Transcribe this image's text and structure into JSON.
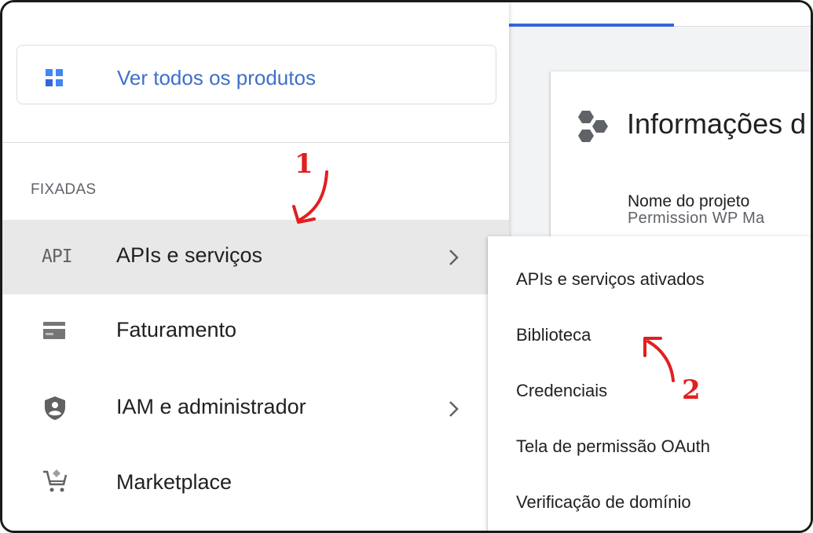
{
  "nav": {
    "all_products": {
      "label": "Ver todos os produtos",
      "icon": "grid-icon"
    },
    "section_label": "FIXADAS",
    "items": [
      {
        "label": "APIs e serviços",
        "icon": "api-icon",
        "icon_text": "API",
        "has_submenu": true,
        "active": true
      },
      {
        "label": "Faturamento",
        "icon": "billing-icon",
        "has_submenu": false
      },
      {
        "label": "IAM e administrador",
        "icon": "shield-icon",
        "has_submenu": true
      },
      {
        "label": "Marketplace",
        "icon": "cart-icon",
        "has_submenu": false
      }
    ]
  },
  "submenu": {
    "items": [
      {
        "label": "APIs e serviços ativados"
      },
      {
        "label": "Biblioteca"
      },
      {
        "label": "Credenciais"
      },
      {
        "label": "Tela de permissão OAuth"
      },
      {
        "label": "Verificação de domínio"
      }
    ]
  },
  "main": {
    "card_title": "Informações d",
    "project_name_label": "Nome do projeto",
    "project_name_value": "Permission WP Ma"
  },
  "annotations": {
    "step1": "1",
    "step2": "2",
    "color": "#e02020"
  },
  "colors": {
    "link_blue": "#3f6fc9",
    "active_bg": "#e8e8e8",
    "tab_indicator": "#3367d6"
  }
}
